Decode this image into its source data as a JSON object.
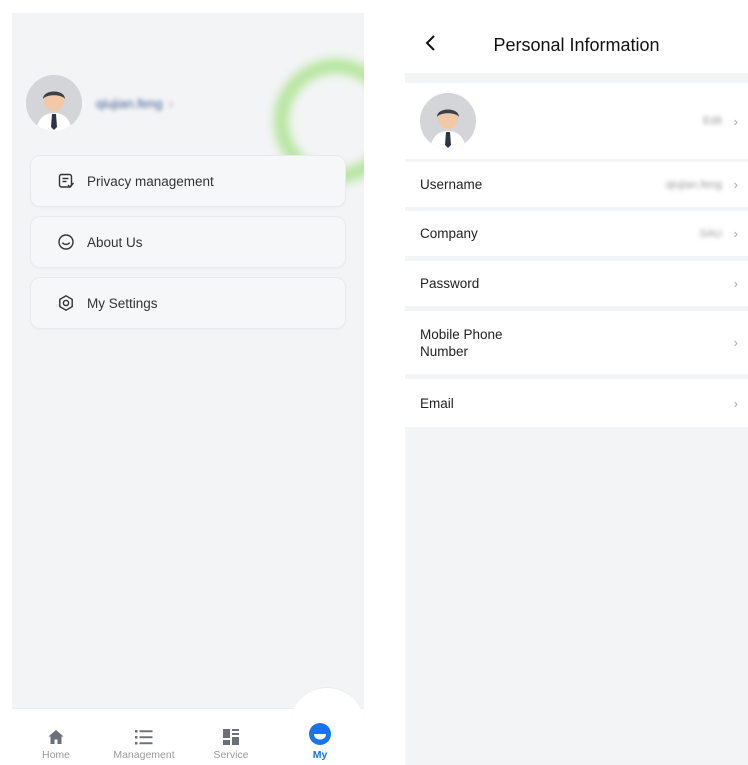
{
  "left": {
    "profile": {
      "username": "qiujian.feng",
      "arrow": "›"
    },
    "menu": [
      {
        "label": "Privacy management",
        "icon": "privacy-note-icon"
      },
      {
        "label": "About Us",
        "icon": "about-circle-icon"
      },
      {
        "label": "My Settings",
        "icon": "settings-hex-icon"
      }
    ],
    "tabs": [
      {
        "label": "Home",
        "icon": "home-icon"
      },
      {
        "label": "Management",
        "icon": "list-icon"
      },
      {
        "label": "Service",
        "icon": "grid-icon"
      },
      {
        "label": "My",
        "icon": "my-icon",
        "active": true
      }
    ],
    "colors": {
      "accent": "#1a73e8",
      "ring": "#7fd94f"
    }
  },
  "right": {
    "title": "Personal Information",
    "back_icon": "back-chevron-icon",
    "avatar_row": {
      "value": "Edit",
      "chevron": "›"
    },
    "rows": [
      {
        "label": "Username",
        "value": "qiujian.feng",
        "chevron": "›"
      },
      {
        "label": "Company",
        "value": "SAU",
        "chevron": "›"
      },
      {
        "label": "Password",
        "value": "",
        "chevron": "›"
      },
      {
        "label": "Mobile Phone Number",
        "value": "",
        "chevron": "›"
      },
      {
        "label": "Email",
        "value": "",
        "chevron": "›"
      }
    ]
  }
}
